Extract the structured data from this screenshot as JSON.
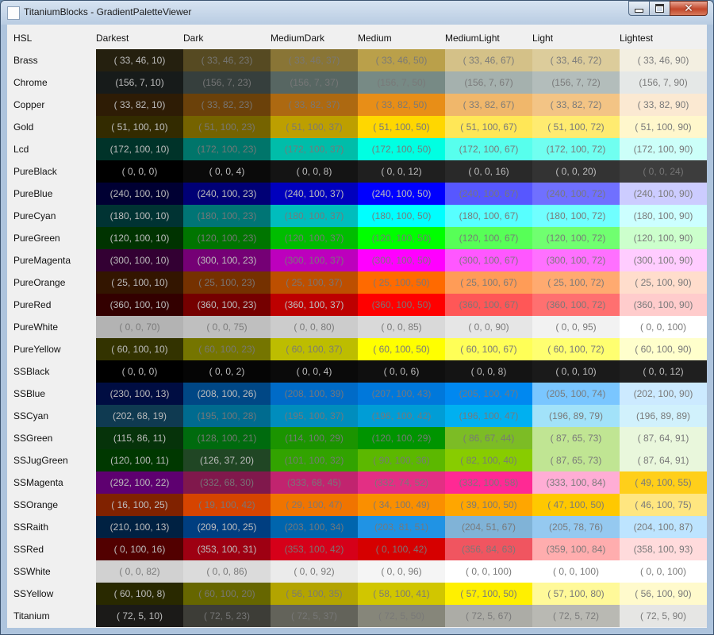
{
  "window": {
    "title": "TitaniumBlocks - GradientPaletteViewer"
  },
  "header": {
    "first": "HSL",
    "columns": [
      "Darkest",
      "Dark",
      "MediumDark",
      "Medium",
      "MediumLight",
      "Light",
      "Lightest"
    ]
  },
  "rows": [
    {
      "name": "Brass",
      "cells": [
        {
          "text": "( 33, 46, 10)",
          "color": "#25200f"
        },
        {
          "text": "( 33, 46, 23)",
          "color": "#564a22"
        },
        {
          "text": "( 33, 46, 37)",
          "color": "#897536"
        },
        {
          "text": "( 33, 46, 50)",
          "color": "#baa04a"
        },
        {
          "text": "( 33, 46, 67)",
          "color": "#d4c188"
        },
        {
          "text": "( 33, 46, 72)",
          "color": "#dccc9b"
        },
        {
          "text": "( 33, 46, 90)",
          "color": "#f3efe1"
        }
      ]
    },
    {
      "name": "Chrome",
      "cells": [
        {
          "text": "(156, 7, 10)",
          "color": "#171b1a"
        },
        {
          "text": "(156, 7, 23)",
          "color": "#363f3d"
        },
        {
          "text": "(156, 7, 37)",
          "color": "#576662"
        },
        {
          "text": "(156, 7, 50)",
          "color": "#778a85"
        },
        {
          "text": "(156, 7, 67)",
          "color": "#a5b1ae"
        },
        {
          "text": "(156, 7, 72)",
          "color": "#b3bdbb"
        },
        {
          "text": "(156, 7, 90)",
          "color": "#e5e8e7"
        }
      ]
    },
    {
      "name": "Copper",
      "cells": [
        {
          "text": "( 33, 82, 10)",
          "color": "#2e1c05"
        },
        {
          "text": "( 33, 82, 23)",
          "color": "#6b410a"
        },
        {
          "text": "( 33, 82, 37)",
          "color": "#ad6911"
        },
        {
          "text": "( 33, 82, 50)",
          "color": "#e88e17"
        },
        {
          "text": "( 33, 82, 67)",
          "color": "#f0b76b"
        },
        {
          "text": "( 33, 82, 72)",
          "color": "#f3c485"
        },
        {
          "text": "( 33, 82, 90)",
          "color": "#fbe9d2"
        }
      ]
    },
    {
      "name": "Gold",
      "cells": [
        {
          "text": "( 51, 100, 10)",
          "color": "#332b00"
        },
        {
          "text": "( 51, 100, 23)",
          "color": "#756300"
        },
        {
          "text": "( 51, 100, 37)",
          "color": "#bd9f00"
        },
        {
          "text": "( 51, 100, 50)",
          "color": "#ffd700"
        },
        {
          "text": "( 51, 100, 67)",
          "color": "#ffe757"
        },
        {
          "text": "( 51, 100, 72)",
          "color": "#ffeb70"
        },
        {
          "text": "( 51, 100, 90)",
          "color": "#fff7cc"
        }
      ]
    },
    {
      "name": "Lcd",
      "cells": [
        {
          "text": "(172, 100, 10)",
          "color": "#003329"
        },
        {
          "text": "(172, 100, 23)",
          "color": "#00756a"
        },
        {
          "text": "(172, 100, 37)",
          "color": "#00bda9"
        },
        {
          "text": "(172, 100, 50)",
          "color": "#00ffe2"
        },
        {
          "text": "(172, 100, 67)",
          "color": "#57ffed"
        },
        {
          "text": "(172, 100, 72)",
          "color": "#70fff0"
        },
        {
          "text": "(172, 100, 90)",
          "color": "#ccfff9"
        }
      ]
    },
    {
      "name": "PureBlack",
      "cells": [
        {
          "text": "( 0, 0, 0)",
          "color": "#000000"
        },
        {
          "text": "( 0, 0, 4)",
          "color": "#0a0a0a"
        },
        {
          "text": "( 0, 0, 8)",
          "color": "#141414"
        },
        {
          "text": "( 0, 0, 12)",
          "color": "#1f1f1f"
        },
        {
          "text": "( 0, 0, 16)",
          "color": "#292929"
        },
        {
          "text": "( 0, 0, 20)",
          "color": "#333333"
        },
        {
          "text": "( 0, 0, 24)",
          "color": "#3d3d3d"
        }
      ]
    },
    {
      "name": "PureBlue",
      "cells": [
        {
          "text": "(240, 100, 10)",
          "color": "#000033"
        },
        {
          "text": "(240, 100, 23)",
          "color": "#000075"
        },
        {
          "text": "(240, 100, 37)",
          "color": "#0000bd"
        },
        {
          "text": "(240, 100, 50)",
          "color": "#0000ff"
        },
        {
          "text": "(240, 100, 67)",
          "color": "#5757ff"
        },
        {
          "text": "(240, 100, 72)",
          "color": "#7070ff"
        },
        {
          "text": "(240, 100, 90)",
          "color": "#ccccff"
        }
      ]
    },
    {
      "name": "PureCyan",
      "cells": [
        {
          "text": "(180, 100, 10)",
          "color": "#003333"
        },
        {
          "text": "(180, 100, 23)",
          "color": "#007575"
        },
        {
          "text": "(180, 100, 37)",
          "color": "#00bdbd"
        },
        {
          "text": "(180, 100, 50)",
          "color": "#00ffff"
        },
        {
          "text": "(180, 100, 67)",
          "color": "#57ffff"
        },
        {
          "text": "(180, 100, 72)",
          "color": "#70ffff"
        },
        {
          "text": "(180, 100, 90)",
          "color": "#ccffff"
        }
      ]
    },
    {
      "name": "PureGreen",
      "cells": [
        {
          "text": "(120, 100, 10)",
          "color": "#003300"
        },
        {
          "text": "(120, 100, 23)",
          "color": "#007500"
        },
        {
          "text": "(120, 100, 37)",
          "color": "#00bd00"
        },
        {
          "text": "(120, 100, 50)",
          "color": "#00ff00"
        },
        {
          "text": "(120, 100, 67)",
          "color": "#57ff57"
        },
        {
          "text": "(120, 100, 72)",
          "color": "#70ff70"
        },
        {
          "text": "(120, 100, 90)",
          "color": "#ccffcc"
        }
      ]
    },
    {
      "name": "PureMagenta",
      "cells": [
        {
          "text": "(300, 100, 10)",
          "color": "#330033"
        },
        {
          "text": "(300, 100, 23)",
          "color": "#750075"
        },
        {
          "text": "(300, 100, 37)",
          "color": "#bd00bd"
        },
        {
          "text": "(300, 100, 50)",
          "color": "#ff00ff"
        },
        {
          "text": "(300, 100, 67)",
          "color": "#ff57ff"
        },
        {
          "text": "(300, 100, 72)",
          "color": "#ff70ff"
        },
        {
          "text": "(300, 100, 90)",
          "color": "#ffccff"
        }
      ]
    },
    {
      "name": "PureOrange",
      "cells": [
        {
          "text": "( 25, 100, 10)",
          "color": "#331500"
        },
        {
          "text": "( 25, 100, 23)",
          "color": "#753100"
        },
        {
          "text": "( 25, 100, 37)",
          "color": "#bd4f00"
        },
        {
          "text": "( 25, 100, 50)",
          "color": "#ff6a00"
        },
        {
          "text": "( 25, 100, 67)",
          "color": "#ff9c57"
        },
        {
          "text": "( 25, 100, 72)",
          "color": "#ffaa70"
        },
        {
          "text": "( 25, 100, 90)",
          "color": "#ffddcc"
        }
      ]
    },
    {
      "name": "PureRed",
      "cells": [
        {
          "text": "(360, 100, 10)",
          "color": "#330000"
        },
        {
          "text": "(360, 100, 23)",
          "color": "#750000"
        },
        {
          "text": "(360, 100, 37)",
          "color": "#bd0000"
        },
        {
          "text": "(360, 100, 50)",
          "color": "#ff0000"
        },
        {
          "text": "(360, 100, 67)",
          "color": "#ff5757"
        },
        {
          "text": "(360, 100, 72)",
          "color": "#ff7070"
        },
        {
          "text": "(360, 100, 90)",
          "color": "#ffcccc"
        }
      ]
    },
    {
      "name": "PureWhite",
      "cells": [
        {
          "text": "( 0, 0, 70)",
          "color": "#b3b3b3"
        },
        {
          "text": "( 0, 0, 75)",
          "color": "#bfbfbf"
        },
        {
          "text": "( 0, 0, 80)",
          "color": "#cccccc"
        },
        {
          "text": "( 0, 0, 85)",
          "color": "#d9d9d9"
        },
        {
          "text": "( 0, 0, 90)",
          "color": "#e6e6e6"
        },
        {
          "text": "( 0, 0, 95)",
          "color": "#f2f2f2"
        },
        {
          "text": "( 0, 0, 100)",
          "color": "#ffffff"
        }
      ]
    },
    {
      "name": "PureYellow",
      "cells": [
        {
          "text": "( 60, 100, 10)",
          "color": "#333300"
        },
        {
          "text": "( 60, 100, 23)",
          "color": "#757500"
        },
        {
          "text": "( 60, 100, 37)",
          "color": "#bdbd00"
        },
        {
          "text": "( 60, 100, 50)",
          "color": "#ffff00"
        },
        {
          "text": "( 60, 100, 67)",
          "color": "#ffff57"
        },
        {
          "text": "( 60, 100, 72)",
          "color": "#ffff70"
        },
        {
          "text": "( 60, 100, 90)",
          "color": "#ffffcc"
        }
      ]
    },
    {
      "name": "SSBlack",
      "cells": [
        {
          "text": "( 0, 0, 0)",
          "color": "#000000"
        },
        {
          "text": "( 0, 0, 2)",
          "color": "#050505"
        },
        {
          "text": "( 0, 0, 4)",
          "color": "#0a0a0a"
        },
        {
          "text": "( 0, 0, 6)",
          "color": "#0f0f0f"
        },
        {
          "text": "( 0, 0, 8)",
          "color": "#141414"
        },
        {
          "text": "( 0, 0, 10)",
          "color": "#1a1a1a"
        },
        {
          "text": "( 0, 0, 12)",
          "color": "#1f1f1f"
        }
      ]
    },
    {
      "name": "SSBlue",
      "cells": [
        {
          "text": "(230, 100, 13)",
          "color": "#000d42"
        },
        {
          "text": "(208, 100, 26)",
          "color": "#004785"
        },
        {
          "text": "(208, 100, 39)",
          "color": "#006bc7"
        },
        {
          "text": "(207, 100, 43)",
          "color": "#0078db"
        },
        {
          "text": "(205, 100, 47)",
          "color": "#0088f0"
        },
        {
          "text": "(205, 100, 74)",
          "color": "#7ac6ff"
        },
        {
          "text": "(202, 100, 90)",
          "color": "#cceaff"
        }
      ]
    },
    {
      "name": "SSCyan",
      "cells": [
        {
          "text": "(202, 68, 19)",
          "color": "#0f3a51"
        },
        {
          "text": "(195, 100, 28)",
          "color": "#006b8f"
        },
        {
          "text": "(195, 100, 37)",
          "color": "#008dbd"
        },
        {
          "text": "(196, 100, 42)",
          "color": "#009dd6"
        },
        {
          "text": "(196, 100, 47)",
          "color": "#00b0f0"
        },
        {
          "text": "(196, 89, 79)",
          "color": "#a2e2f9"
        },
        {
          "text": "(196, 89, 89)",
          "color": "#d1f1fc"
        }
      ]
    },
    {
      "name": "SSGreen",
      "cells": [
        {
          "text": "(115, 86, 11)",
          "color": "#06330a"
        },
        {
          "text": "(128, 100, 21)",
          "color": "#006b0e"
        },
        {
          "text": "(114, 100, 29)",
          "color": "#1b9400"
        },
        {
          "text": "(120, 100, 29)",
          "color": "#009400"
        },
        {
          "text": "( 86, 67, 44)",
          "color": "#7cbc25"
        },
        {
          "text": "( 87, 65, 73)",
          "color": "#c0e593"
        },
        {
          "text": "( 87, 64, 91)",
          "color": "#e9f7dc"
        }
      ]
    },
    {
      "name": "SSJugGreen",
      "cells": [
        {
          "text": "(120, 100, 11)",
          "color": "#003800"
        },
        {
          "text": "(126, 37, 20)",
          "color": "#204624"
        },
        {
          "text": "(101, 100, 32)",
          "color": "#32a300"
        },
        {
          "text": "( 90, 100, 36)",
          "color": "#5cb800"
        },
        {
          "text": "( 82, 100, 40)",
          "color": "#88cc00"
        },
        {
          "text": "( 87, 65, 73)",
          "color": "#c0e593"
        },
        {
          "text": "( 87, 64, 91)",
          "color": "#e9f7dc"
        }
      ]
    },
    {
      "name": "SSMagenta",
      "cells": [
        {
          "text": "(292, 100, 22)",
          "color": "#5e0070"
        },
        {
          "text": "(332, 68, 30)",
          "color": "#80184c"
        },
        {
          "text": "(333, 68, 45)",
          "color": "#c1246f"
        },
        {
          "text": "(332, 74, 52)",
          "color": "#e32f84"
        },
        {
          "text": "(332, 100, 58)",
          "color": "#ff2994"
        },
        {
          "text": "(333, 100, 84)",
          "color": "#ffadd5"
        },
        {
          "text": "( 49, 100, 55)",
          "color": "#ffcf1a"
        }
      ]
    },
    {
      "name": "SSOrange",
      "cells": [
        {
          "text": "( 16, 100, 25)",
          "color": "#802200"
        },
        {
          "text": "( 19, 100, 42)",
          "color": "#d64400"
        },
        {
          "text": "( 29, 100, 47)",
          "color": "#f07400"
        },
        {
          "text": "( 34, 100, 49)",
          "color": "#fa8f00"
        },
        {
          "text": "( 39, 100, 50)",
          "color": "#ffa600"
        },
        {
          "text": "( 47, 100, 50)",
          "color": "#ffc800"
        },
        {
          "text": "( 46, 100, 75)",
          "color": "#ffe680"
        }
      ]
    },
    {
      "name": "SSRaith",
      "cells": [
        {
          "text": "(210, 100, 13)",
          "color": "#002142"
        },
        {
          "text": "(209, 100, 25)",
          "color": "#003e80"
        },
        {
          "text": "(203, 100, 34)",
          "color": "#0065ad"
        },
        {
          "text": "(203, 81, 51)",
          "color": "#2093e4"
        },
        {
          "text": "(204, 51, 67)",
          "color": "#80b3d7"
        },
        {
          "text": "(205, 78, 76)",
          "color": "#95c9f0"
        },
        {
          "text": "(204, 100, 87)",
          "color": "#bde4ff"
        }
      ]
    },
    {
      "name": "SSRed",
      "cells": [
        {
          "text": "( 0, 100, 16)",
          "color": "#520000"
        },
        {
          "text": "(353, 100, 31)",
          "color": "#9e0012"
        },
        {
          "text": "(353, 100, 42)",
          "color": "#d60019"
        },
        {
          "text": "( 0, 100, 42)",
          "color": "#d60000"
        },
        {
          "text": "(356, 84, 63)",
          "color": "#f05560"
        },
        {
          "text": "(359, 100, 84)",
          "color": "#ffadae"
        },
        {
          "text": "(358, 100, 93)",
          "color": "#ffdbdc"
        }
      ]
    },
    {
      "name": "SSWhite",
      "cells": [
        {
          "text": "( 0, 0, 82)",
          "color": "#d1d1d1"
        },
        {
          "text": "( 0, 0, 86)",
          "color": "#dbdbdb"
        },
        {
          "text": "( 0, 0, 92)",
          "color": "#ebebeb"
        },
        {
          "text": "( 0, 0, 96)",
          "color": "#f5f5f5"
        },
        {
          "text": "( 0, 0, 100)",
          "color": "#ffffff"
        },
        {
          "text": "( 0, 0, 100)",
          "color": "#ffffff"
        },
        {
          "text": "( 0, 0, 100)",
          "color": "#ffffff"
        }
      ]
    },
    {
      "name": "SSYellow",
      "cells": [
        {
          "text": "( 60, 100, 8)",
          "color": "#292900"
        },
        {
          "text": "( 60, 100, 20)",
          "color": "#666600"
        },
        {
          "text": "( 56, 100, 35)",
          "color": "#b3a400"
        },
        {
          "text": "( 58, 100, 41)",
          "color": "#d1c600"
        },
        {
          "text": "( 57, 100, 50)",
          "color": "#fff000"
        },
        {
          "text": "( 57, 100, 80)",
          "color": "#fff999"
        },
        {
          "text": "( 56, 100, 90)",
          "color": "#fffacc"
        }
      ]
    },
    {
      "name": "Titanium",
      "cells": [
        {
          "text": "( 72, 5, 10)",
          "color": "#1b1a18"
        },
        {
          "text": "( 72, 5, 23)",
          "color": "#3d3d37"
        },
        {
          "text": "( 72, 5, 37)",
          "color": "#63635a"
        },
        {
          "text": "( 72, 5, 50)",
          "color": "#86867a"
        },
        {
          "text": "( 72, 5, 67)",
          "color": "#acaca6"
        },
        {
          "text": "( 72, 5, 72)",
          "color": "#b9b9b3"
        },
        {
          "text": "( 72, 5, 90)",
          "color": "#e6e6e4"
        }
      ]
    }
  ]
}
